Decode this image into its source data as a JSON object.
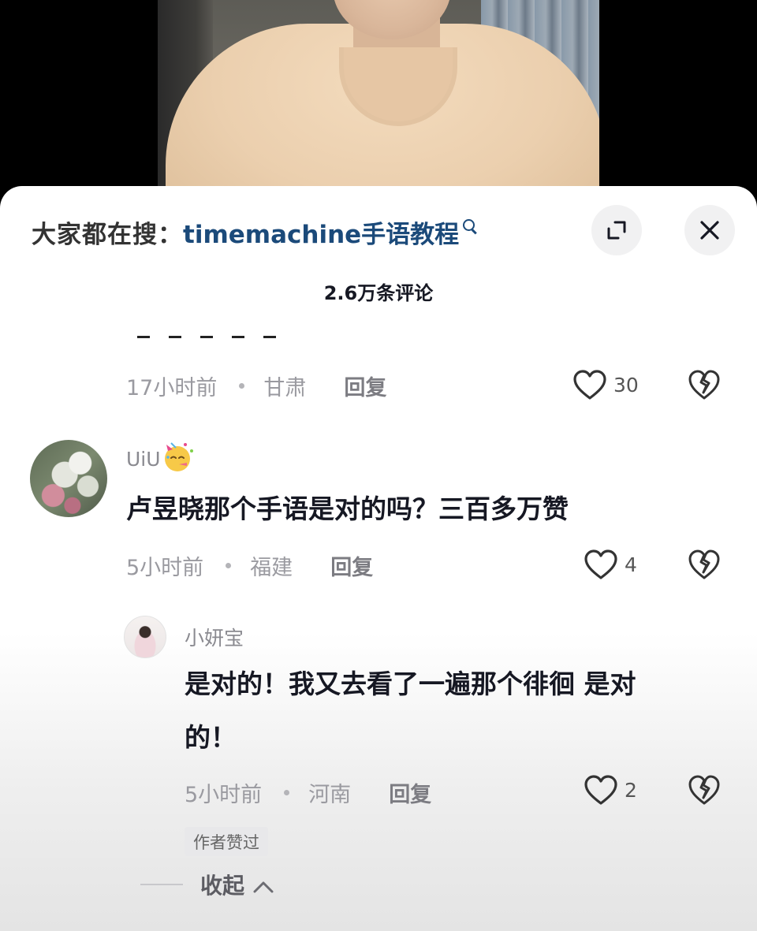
{
  "search_bar": {
    "prefix": "大家都在搜：",
    "term": "timemachine手语教程"
  },
  "header": {
    "comment_count": "2.6万条评论"
  },
  "comments": [
    {
      "time": "17小时前",
      "location": "甘肃",
      "reply_label": "回复",
      "likes": "30"
    },
    {
      "username": "UiU",
      "text": "卢昱晓那个手语是对的吗？三百多万赞",
      "time": "5小时前",
      "location": "福建",
      "reply_label": "回复",
      "likes": "4",
      "replies": [
        {
          "username": "小妍宝",
          "text_line1": "是对的！我又去看了一遍那个徘徊 是对",
          "text_line2": "的！",
          "time": "5小时前",
          "location": "河南",
          "reply_label": "回复",
          "likes": "2",
          "badge": "作者赞过"
        }
      ],
      "collapse_label": "收起"
    }
  ],
  "icons": {
    "search": "search-icon",
    "expand": "expand-icon",
    "close": "close-icon",
    "like": "heart-icon",
    "dislike": "broken-heart-icon",
    "collapse": "chevron-up-icon"
  },
  "colors": {
    "search_term": "#1b4a7a",
    "text_primary": "#161823",
    "text_secondary": "#9a9aa0",
    "button_bg": "#f1f1f2"
  }
}
